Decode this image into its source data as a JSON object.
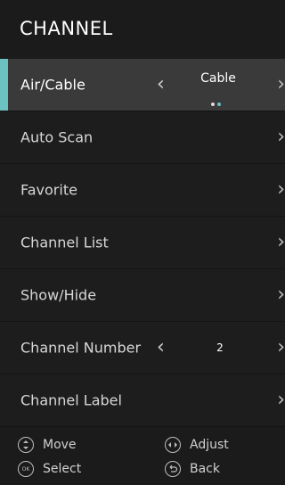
{
  "title": "CHANNEL",
  "menu": [
    {
      "label": "Air/Cable",
      "value": "Cable"
    },
    {
      "label": "Auto Scan"
    },
    {
      "label": "Favorite"
    },
    {
      "label": "Channel List"
    },
    {
      "label": "Show/Hide"
    },
    {
      "label": "Channel Number",
      "value": "2"
    },
    {
      "label": "Channel Label"
    }
  ],
  "footer": {
    "move": "Move",
    "adjust": "Adjust",
    "select": "Select",
    "back": "Back",
    "ok_icon_text": "OK"
  },
  "colors": {
    "accent": "#6cc2c0",
    "background": "#1b1b1b",
    "selected_row": "#3a3a3a"
  },
  "icons": {
    "left": "chevron-left-icon",
    "right": "chevron-right-icon",
    "move": "up-down-icon",
    "adjust": "left-right-icon",
    "select": "ok-icon",
    "back": "back-icon"
  }
}
